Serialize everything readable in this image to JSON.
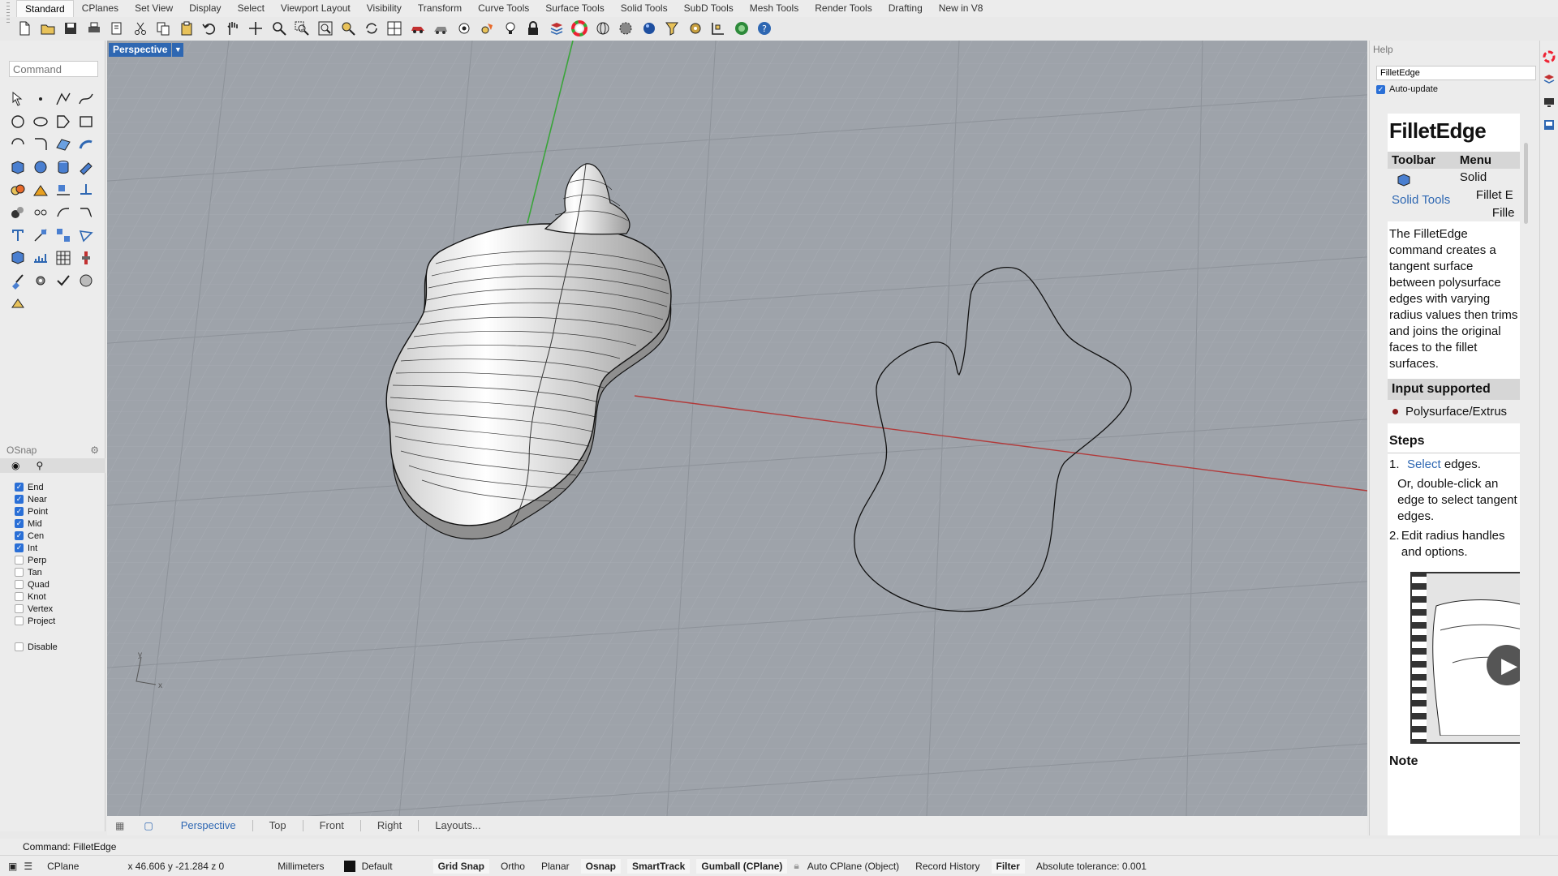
{
  "tabs": [
    "Standard",
    "CPlanes",
    "Set View",
    "Display",
    "Select",
    "Viewport Layout",
    "Visibility",
    "Transform",
    "Curve Tools",
    "Surface Tools",
    "Solid Tools",
    "SubD Tools",
    "Mesh Tools",
    "Render Tools",
    "Drafting",
    "New in V8"
  ],
  "active_tab": "Standard",
  "toolbar_icons": [
    "new-icon",
    "open-icon",
    "save-icon",
    "print-icon",
    "import-icon",
    "cut-icon",
    "copy-icon",
    "paste-icon",
    "undo-icon",
    "pan-icon",
    "move-view-icon",
    "zoom-icon",
    "zoom-window-icon",
    "zoom-extents-icon",
    "zoom-selected-icon",
    "rotate-view-icon",
    "four-viewports-icon",
    "car-icon",
    "rendered-icon",
    "hide-icon",
    "show-icon",
    "light-icon",
    "lock-icon",
    "layer-icon",
    "color-wheel-icon",
    "sphere-display-icon",
    "material-icon",
    "render-icon",
    "select-filter-icon",
    "options-icon",
    "grid-icon",
    "rhino-web-icon",
    "help-icon"
  ],
  "command": {
    "placeholder": "Command"
  },
  "osnap": {
    "title": "OSnap",
    "items": [
      {
        "label": "End",
        "checked": true
      },
      {
        "label": "Near",
        "checked": true
      },
      {
        "label": "Point",
        "checked": true
      },
      {
        "label": "Mid",
        "checked": true
      },
      {
        "label": "Cen",
        "checked": true
      },
      {
        "label": "Int",
        "checked": true
      },
      {
        "label": "Perp",
        "checked": false
      },
      {
        "label": "Tan",
        "checked": false
      },
      {
        "label": "Quad",
        "checked": false
      },
      {
        "label": "Knot",
        "checked": false
      },
      {
        "label": "Vertex",
        "checked": false
      },
      {
        "label": "Project",
        "checked": false
      }
    ],
    "disable_label": "Disable"
  },
  "viewport": {
    "name": "Perspective",
    "axis_x": "x",
    "axis_y": "y"
  },
  "viewport_tabs": [
    "Perspective",
    "Top",
    "Front",
    "Right",
    "Layouts..."
  ],
  "active_viewport_tab": "Perspective",
  "help": {
    "title": "Help",
    "search_value": "FilletEdge",
    "auto_update_label": "Auto-update",
    "doc_title": "FilletEdge",
    "toolbar_header": "Toolbar",
    "menu_header": "Menu",
    "toolbar_link": "Solid Tools",
    "menu_items": [
      "Solid",
      "Fillet E",
      "Fille"
    ],
    "description": "The FilletEdge command creates a tangent surface between polysurface edges with varying radius values then trims and joins the original faces to the fillet surfaces.",
    "input_header": "Input supported",
    "input_item": "Polysurface/Extrus",
    "steps_header": "Steps",
    "step1_link": "Select",
    "step1_rest": " edges.",
    "step1_note": "Or, double-click an edge to select tangent edges.",
    "step2": "Edit radius handles and options.",
    "note_header": "Note"
  },
  "command_history": "Command: FilletEdge",
  "status": {
    "cplane": "CPlane",
    "coords": "x 46.606  y -21.284  z 0",
    "units": "Millimeters",
    "layer": "Default",
    "grid_snap": "Grid Snap",
    "ortho": "Ortho",
    "planar": "Planar",
    "osnap": "Osnap",
    "smarttrack": "SmartTrack",
    "gumball": "Gumball (CPlane)",
    "auto_cplane": "Auto CPlane (Object)",
    "record_history": "Record History",
    "filter": "Filter",
    "tolerance": "Absolute tolerance: 0.001"
  },
  "colors": {
    "accent": "#2e67b2",
    "viewport_bg": "#9ea3aa",
    "x_axis": "#b23a3a",
    "y_axis": "#3aa43a"
  }
}
